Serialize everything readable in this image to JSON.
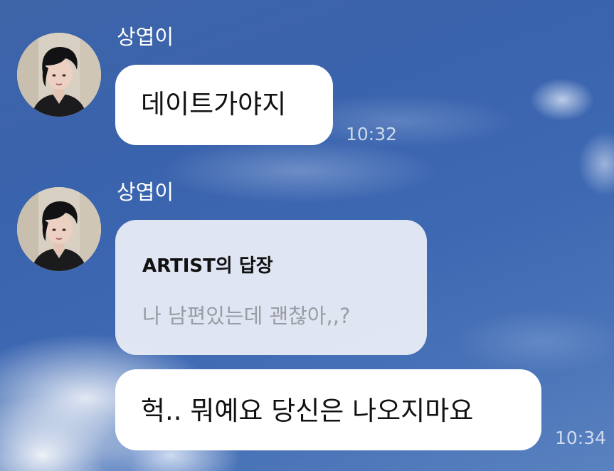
{
  "messages": [
    {
      "sender": "상엽이",
      "text": "데이트가야지",
      "time": "10:32"
    },
    {
      "sender": "상엽이",
      "reply": {
        "title": "ARTIST의 답장",
        "quoted_text": "나 남편있는데 괜찮아,,?"
      },
      "text": "헉.. 뭐예요 당신은 나오지마요",
      "time": "10:34"
    }
  ],
  "colors": {
    "bubble": "#ffffff",
    "reply_bubble": "#eceff6",
    "quoted_text": "#9a9ca3",
    "sender_name": "#ffffff",
    "sky": "#3a63ad"
  },
  "icons": {
    "avatar": "profile-photo-avatar"
  }
}
